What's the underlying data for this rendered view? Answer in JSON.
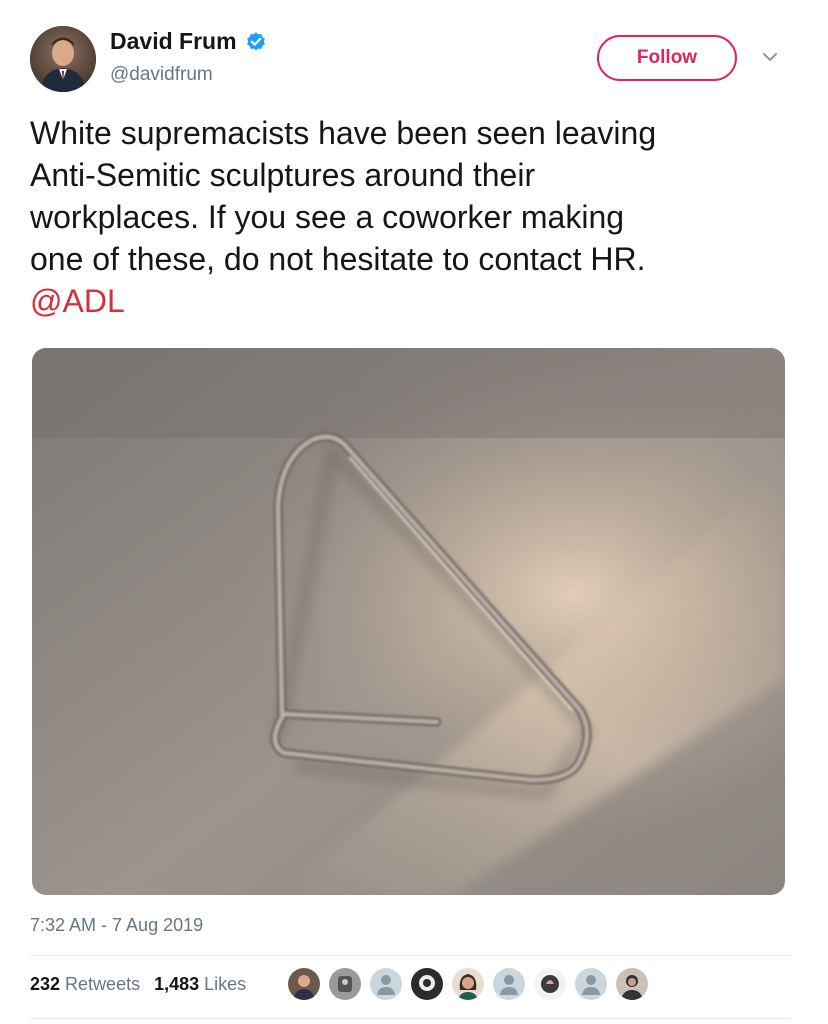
{
  "author": {
    "name": "David Frum",
    "handle": "@davidfrum",
    "verified_color": "#1da1f2"
  },
  "actions": {
    "follow_label": "Follow",
    "more_icon": "chevron-down-icon"
  },
  "tweet": {
    "text": "White supremacists have been seen leaving\nAnti-Semitic sculptures around their\nworkplaces.  If you see a coworker making\none of these, do not hesitate to contact HR.",
    "mention": "@ADL",
    "timestamp": "7:32 AM - 7 Aug 2019"
  },
  "stats": {
    "retweets_count": "232",
    "retweets_label": "Retweets",
    "likes_count": "1,483",
    "likes_label": "Likes"
  },
  "likers": [
    "photo",
    "photo",
    "default",
    "photo",
    "photo",
    "default",
    "photo",
    "default",
    "photo"
  ],
  "colors": {
    "follow_accent": "#e0245e",
    "mention": "#d4303b",
    "secondary_text": "#657786"
  }
}
